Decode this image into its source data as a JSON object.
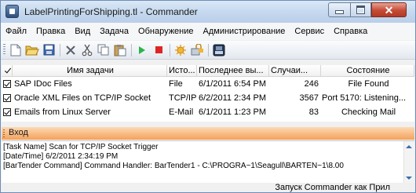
{
  "window": {
    "title": "LabelPrintingForShipping.tl - Commander",
    "minimize_icon": "minimize-icon",
    "maximize_icon": "maximize-icon",
    "close_glyph": "✕"
  },
  "menu": {
    "items": [
      {
        "label": "Файл"
      },
      {
        "label": "Правка"
      },
      {
        "label": "Вид"
      },
      {
        "label": "Задача"
      },
      {
        "label": "Обнаружение"
      },
      {
        "label": "Администрирование"
      },
      {
        "label": "Сервис"
      },
      {
        "label": "Справка"
      }
    ]
  },
  "toolbar": {
    "icons": [
      "new-icon",
      "open-icon",
      "save-icon",
      "delete-icon",
      "cut-icon",
      "copy-icon",
      "paste-icon",
      "start-icon",
      "stop-icon",
      "options-icon",
      "permissions-icon",
      "printer-icon"
    ]
  },
  "tasks": {
    "columns": [
      {
        "label": ""
      },
      {
        "label": "Имя задачи"
      },
      {
        "label": "Исто..."
      },
      {
        "label": "Последнее вы..."
      },
      {
        "label": "Случаи..."
      },
      {
        "label": "Состояние"
      }
    ],
    "rows": [
      {
        "checked": true,
        "name": "SAP IDoc Files",
        "source": "File",
        "last": "6/1/2011 6:54 PM",
        "count": "246",
        "state": "File Found"
      },
      {
        "checked": true,
        "name": "Oracle XML Files on TCP/IP Socket",
        "source": "TCP/IP",
        "last": "6/2/2011 2:34 PM",
        "count": "3567",
        "state": "Port 5170: Listening..."
      },
      {
        "checked": true,
        "name": "Emails from Linux Server",
        "source": "E-Mail",
        "last": "6/1/2011 1:23 PM",
        "count": "83",
        "state": "Checking Mail"
      }
    ]
  },
  "log": {
    "title": "Вход",
    "lines": [
      "[Task Name] Scan for TCP/IP Socket Trigger",
      "[Date/Time] 6/2/2011 2:34:19 PM",
      "[BarTender Command] Command Handler: BarTender1 - C:\\PROGRA~1\\Seagull\\BARTEN~1\\8.00"
    ]
  },
  "status": {
    "text": "Запуск Commander как Прил"
  },
  "colors": {
    "title_gradient_top": "#dbe8f6",
    "log_header": "#f4a25b",
    "close_button": "#c44a35",
    "start_icon": "#2db34a",
    "stop_icon": "#e02424"
  }
}
